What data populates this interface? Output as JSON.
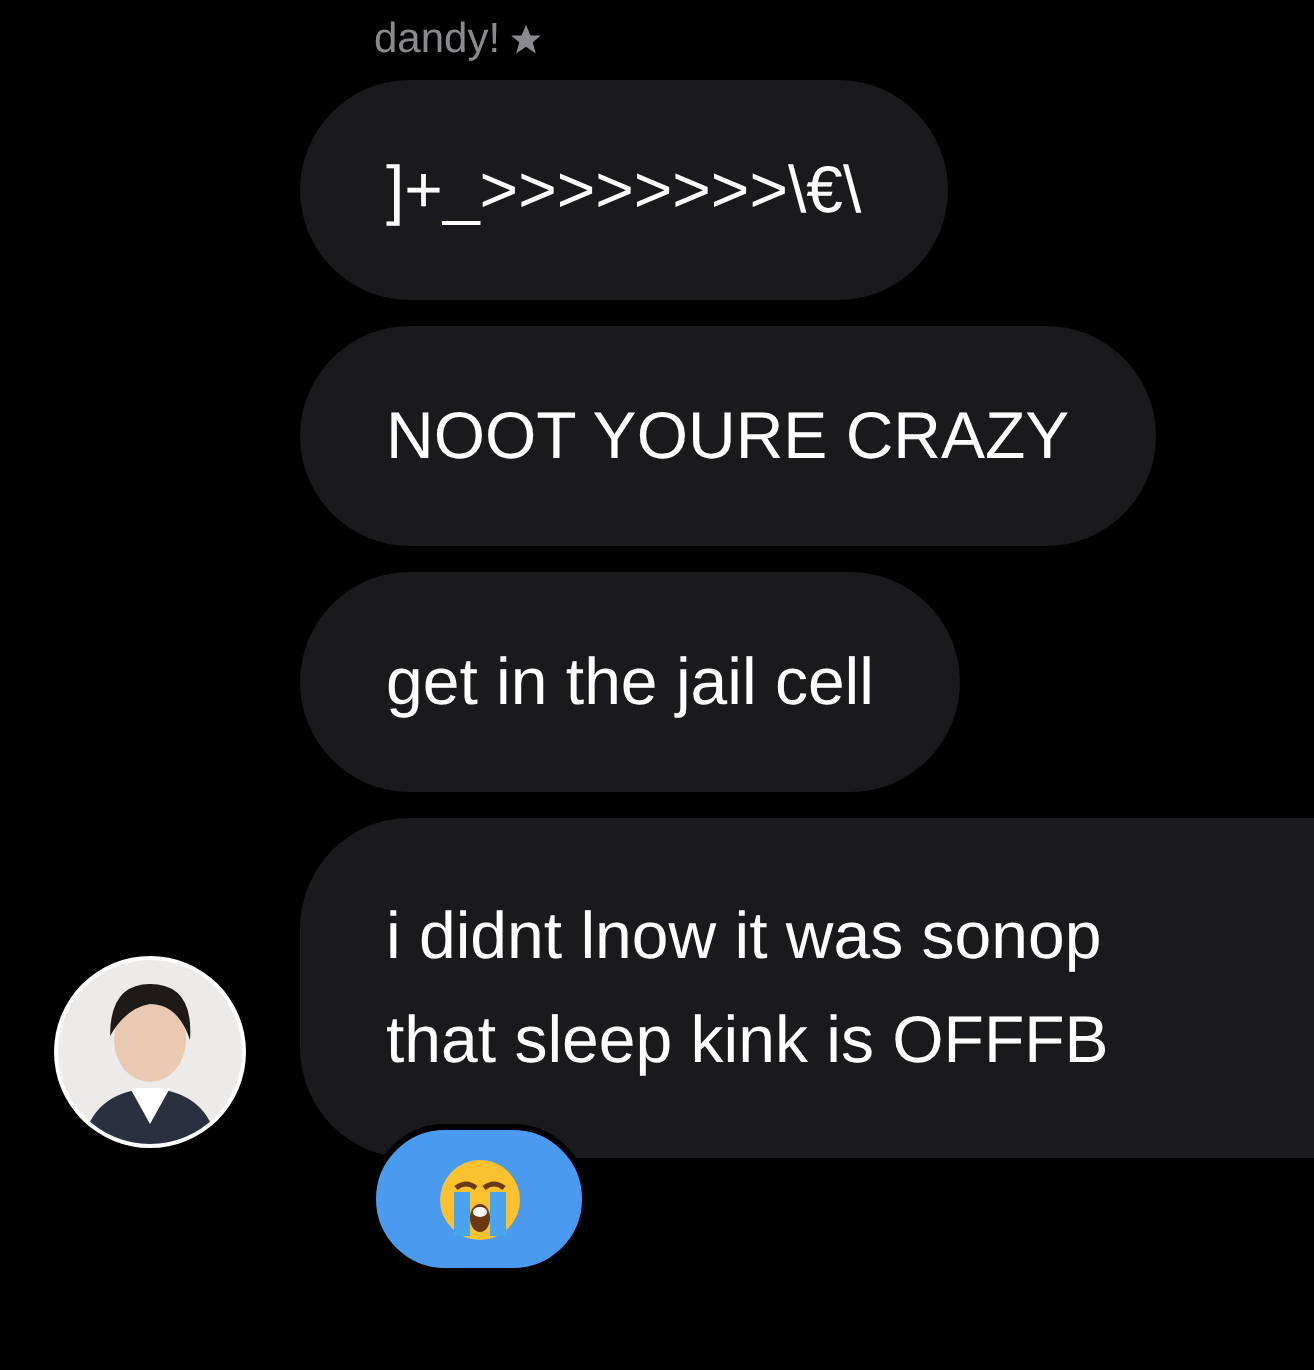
{
  "sender": {
    "name": "dandy!",
    "starred": true
  },
  "messages": [
    {
      "lines": [
        "]+_>>>>>>>>\\€\\"
      ],
      "cut": false
    },
    {
      "lines": [
        "NOOT YOURE CRAZY"
      ],
      "cut": false
    },
    {
      "lines": [
        "get in the jail cell"
      ],
      "cut": false
    },
    {
      "lines": [
        "i didnt lnow it was sonop",
        "that sleep kink is OFFFB"
      ],
      "cut": true
    }
  ],
  "reaction": {
    "kind": "crying"
  }
}
